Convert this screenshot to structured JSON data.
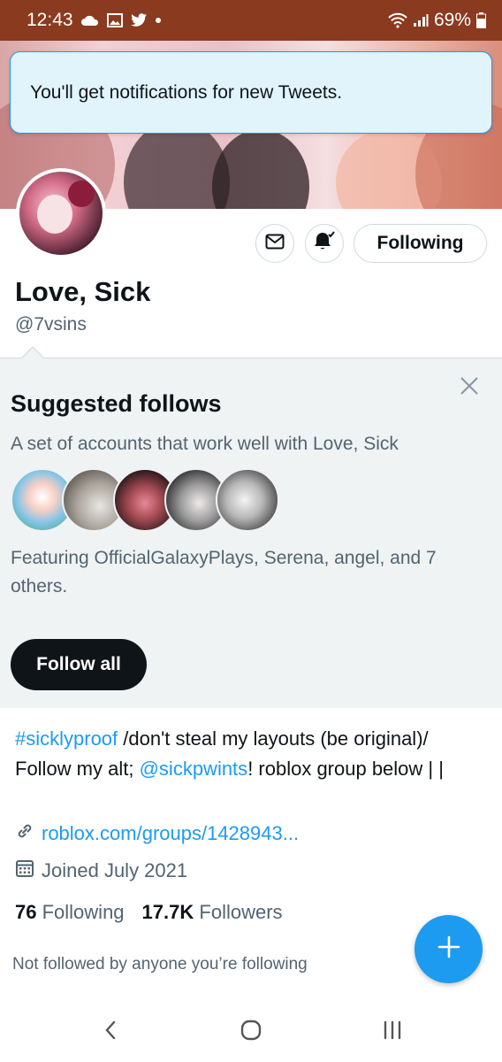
{
  "status_bar": {
    "time": "12:43",
    "battery": "69%"
  },
  "toast": {
    "text": "You'll get notifications for new Tweets."
  },
  "profile": {
    "name": "Love, Sick",
    "handle": "@7vsins",
    "following_button": "Following"
  },
  "suggested": {
    "title": "Suggested follows",
    "subtitle": "A set of accounts that work well with Love, Sick",
    "featuring": "Featuring OfficialGalaxyPlays, Serena, angel, and 7 others.",
    "follow_all": "Follow all"
  },
  "bio": {
    "hashtag": "#sicklyproof",
    "text1": " /don't steal my layouts (be original)/  Follow my alt; ",
    "mention": "@sickpwints",
    "text2": "!  roblox group below | |"
  },
  "meta": {
    "link": "roblox.com/groups/1428943...",
    "joined": "Joined July 2021"
  },
  "stats": {
    "following_count": "76",
    "following_label": "Following",
    "followers_count": "17.7K",
    "followers_label": "Followers"
  },
  "not_followed": "Not followed by anyone you’re following",
  "colors": {
    "accent": "#1d9bf0",
    "status_bar": "#8a3a1e",
    "suggest_bg": "#eff3f4"
  }
}
